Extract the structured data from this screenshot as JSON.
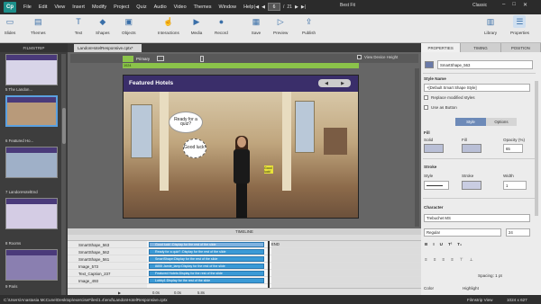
{
  "app": {
    "logo": "Cp"
  },
  "menu": [
    "File",
    "Edit",
    "View",
    "Insert",
    "Modify",
    "Project",
    "Quiz",
    "Audio",
    "Video",
    "Themes",
    "Window",
    "Help"
  ],
  "pager": {
    "current": "6",
    "total": "21",
    "sep": "/"
  },
  "zoom_mode": "Best Fit",
  "workspace": "Classic",
  "toolbar": {
    "slides": "Slides",
    "themes": "Themes",
    "text": "Text",
    "shapes": "Shapes",
    "objects": "Objects",
    "interactions": "Interactions",
    "media": "Media",
    "record": "Record",
    "save": "Save",
    "preview": "Preview",
    "publish": "Publish",
    "library": "Library",
    "properties": "Properties"
  },
  "filmstrip": {
    "tab": "FILMSTRIP",
    "items": [
      {
        "label": "5"
      },
      {
        "label": "5 The Landon..."
      },
      {
        "label": "6 Featured Ho..."
      },
      {
        "label": "7 LandonHotelEnd"
      },
      {
        "label": "8 Rooms"
      },
      {
        "label": "9 Paris"
      }
    ]
  },
  "document_tab": "LandonHotelResponsive.cptx*",
  "canvas": {
    "primary_label": "Primary",
    "ruler_value": "1024",
    "view_device_height": "View Device Height",
    "slide_title": "Featured Hotels",
    "nav_prev": "◀",
    "nav_next": "▶",
    "bubble1": "Ready for a quiz?",
    "bubble2": "Good luck!",
    "tag": "Good luck!"
  },
  "timeline": {
    "header": "TIMELINE",
    "end_label": "END",
    "rows": [
      {
        "name": "SmartShape_563",
        "bar": "Good luck! :Display for the rest of the slide"
      },
      {
        "name": "SmartShape_562",
        "bar": "Ready for a quiz? :Display for the rest of the slide"
      },
      {
        "name": "SmartShape_561",
        "bar": "SmartShape:Display for the rest of the slide"
      },
      {
        "name": "Image_573",
        "bar": "8855 Jamie_lamp:Display for the rest of the slide"
      },
      {
        "name": "Text_Caption_237",
        "bar": "Featured Hotels:Display for the rest of the slide"
      },
      {
        "name": "Image_493",
        "bar": "Lobby1:Display for the rest of the slide"
      }
    ],
    "footer": {
      "time1": "0.0s",
      "time2": "0.0s",
      "time3": "5.8s"
    }
  },
  "properties": {
    "tabs": [
      "PROPERTIES",
      "TIMING",
      "POSITION"
    ],
    "object_name": "SmartShape_563",
    "style_name_label": "Style Name",
    "style_name_value": "+[Default Smart Shape Style]",
    "replace_modified": "Replace modified styles",
    "use_as_button": "Use as Button",
    "sub_tabs": [
      "Style",
      "Options"
    ],
    "fill_label": "Fill",
    "solid_label": "Solid",
    "fill_sub_label": "Fill",
    "opacity_label": "Opacity (%)",
    "opacity_value": "65",
    "stroke_label": "Stroke",
    "stroke_style_label": "Style",
    "stroke_stroke_label": "Stroke",
    "width_label": "Width",
    "width_value": "1",
    "character_label": "Character",
    "font_name": "Trebuchet MS",
    "font_style": "Regular",
    "font_size": "24",
    "spacing_label": "Spacing: 1 pt",
    "color_label": "Color",
    "highlight_label": "Highlight",
    "colors": {
      "fill": "#b9bfd6",
      "stroke": "#c9cde2",
      "highlight": "#a6c6e8"
    }
  },
  "status": {
    "path": "C:\\Users\\Anastasia McCune\\Desktop\\exerciseFiles\\1.4\\end\\LandonHotelResponsive.cptx",
    "view": "Filmstrip View",
    "size": "1024 x 627"
  }
}
